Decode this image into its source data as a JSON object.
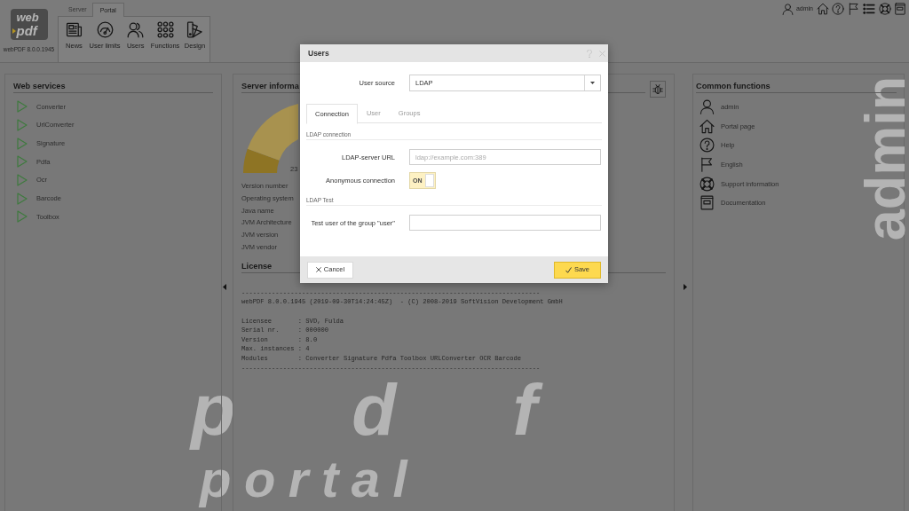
{
  "header": {
    "logo": {
      "top": "web",
      "bottom": "pdf"
    },
    "version": "webPDF 8.0.0.1945",
    "ribbon_tabs": [
      {
        "label": "Server",
        "selected": false
      },
      {
        "label": "Portal",
        "selected": true
      }
    ],
    "ribbon_buttons": [
      {
        "kind": "news",
        "label": "News"
      },
      {
        "kind": "gauge",
        "label": "User limits"
      },
      {
        "kind": "users",
        "label": "Users"
      },
      {
        "kind": "grid",
        "label": "Functions"
      },
      {
        "kind": "swatches",
        "label": "Design"
      }
    ],
    "user_toolbar": [
      {
        "kind": "user",
        "label": "admin"
      },
      {
        "kind": "home"
      },
      {
        "kind": "help"
      },
      {
        "kind": "flag"
      },
      {
        "kind": "list"
      },
      {
        "kind": "lifebuoy"
      },
      {
        "kind": "book"
      }
    ]
  },
  "web_services": {
    "title": "Web services",
    "items": [
      {
        "label": "Converter"
      },
      {
        "label": "UrlConverter"
      },
      {
        "label": "Signature"
      },
      {
        "label": "Pdfa"
      },
      {
        "label": "Ocr"
      },
      {
        "label": "Barcode"
      },
      {
        "label": "Toolbox"
      }
    ]
  },
  "server_info": {
    "title": "Server informa",
    "gauge_label": "23",
    "rows": [
      {
        "label": "Version number"
      },
      {
        "label": "Operating system"
      },
      {
        "label": "Java name"
      },
      {
        "label": "JVM Architecture"
      },
      {
        "label": "JVM version"
      },
      {
        "label": "JVM vendor"
      }
    ],
    "license_title": "License",
    "license_header": [
      "-------------------------------------------------------------------------------",
      "webPDF 8.0.0.1945 (2019-09-30T14:24:45Z)  - (C) 2008-2019 SoftVision Development GmbH"
    ],
    "license_details": [
      "Licensee       : SVD, Fulda",
      "Serial nr.     : 000000",
      "Version        : 8.0",
      "Max. instances : 4",
      "Modules        : Converter Signature Pdfa Toolbox URLConverter OCR Barcode",
      "-------------------------------------------------------------------------------"
    ]
  },
  "common_functions": {
    "title": "Common functions",
    "items": [
      {
        "kind": "user",
        "label": "admin"
      },
      {
        "kind": "home",
        "label": "Portal page"
      },
      {
        "kind": "help",
        "label": "Help"
      },
      {
        "kind": "flag",
        "label": "English"
      },
      {
        "kind": "lifebuoy",
        "label": "Support information"
      },
      {
        "kind": "book",
        "label": "Documentation"
      }
    ],
    "backdrop_text": "admin"
  },
  "background": {
    "large_text": "pdf",
    "caption": "portal"
  },
  "dialog": {
    "title": "Users",
    "user_source": {
      "label": "User source",
      "value": "LDAP"
    },
    "tabs": [
      {
        "label": "Connection",
        "selected": true
      },
      {
        "label": "User",
        "selected": false
      },
      {
        "label": "Groups",
        "selected": false
      }
    ],
    "sections": [
      {
        "title": "LDAP connection",
        "fields": [
          {
            "kind": "text",
            "label": "LDAP-server URL",
            "placeholder": "ldap://example.com:389"
          },
          {
            "kind": "toggle",
            "label": "Anonymous connection",
            "on": true,
            "state_label": "ON"
          }
        ]
      },
      {
        "title": "LDAP Test",
        "fields": [
          {
            "kind": "text",
            "label": "Test user of the group \"user\""
          }
        ]
      }
    ],
    "buttons": [
      {
        "kind": "cancel",
        "label": "Cancel"
      },
      {
        "kind": "save",
        "label": "Save"
      }
    ]
  }
}
